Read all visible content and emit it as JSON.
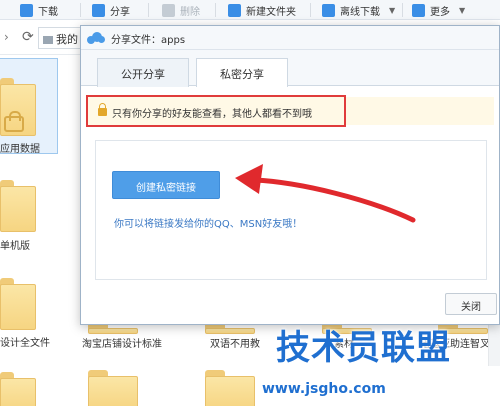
{
  "toolbar": {
    "download": "下载",
    "share": "分享",
    "delete": "删除",
    "new_folder": "新建文件夹",
    "offline_download": "离线下载",
    "more": "更多"
  },
  "navbar": {
    "path_text": "我的"
  },
  "files": [
    {
      "label": "应用数据"
    },
    {
      "label": "单机版"
    },
    {
      "label": "设计全文件"
    },
    {
      "label": "淘宝店铺设计标准"
    },
    {
      "label": "双语不用教"
    },
    {
      "label": "素材"
    },
    {
      "label": "诺基亚助连智叉名"
    }
  ],
  "dialog": {
    "title": "分享文件：apps",
    "tabs": [
      {
        "label": "公开分享",
        "active": false
      },
      {
        "label": "私密分享",
        "active": true
      }
    ],
    "notice": "只有你分享的好友能查看，其他人都看不到哦",
    "create_button": "创建私密链接",
    "hint": "你可以将链接发给你的QQ、MSN好友哦！",
    "close_button": "关闭"
  },
  "watermark": {
    "main": "技术员联盟",
    "url": "www.jsgho.com"
  },
  "colors": {
    "accent": "#4f9ee8",
    "highlight_border": "#e03b3b",
    "arrow": "#e0292d",
    "watermark": "#1f6fd0"
  },
  "icons": {
    "download": "download-icon",
    "share": "share-icon",
    "delete": "trash-icon",
    "new_folder": "new-folder-icon",
    "offline_download": "offline-download-icon",
    "more": "more-icon",
    "lock": "lock-icon",
    "refresh": "refresh-icon",
    "logo": "cloud-logo-icon"
  }
}
